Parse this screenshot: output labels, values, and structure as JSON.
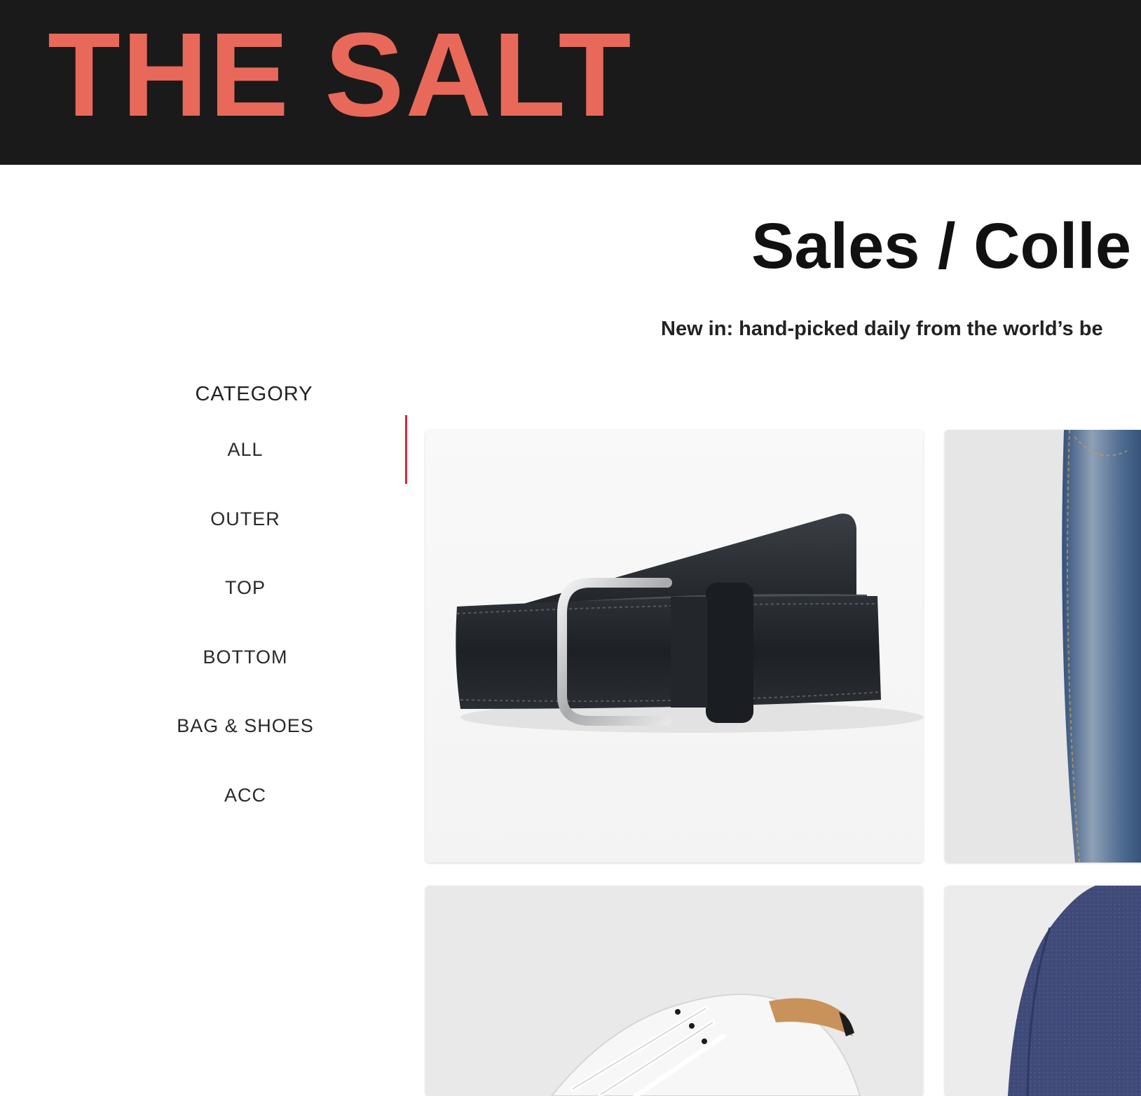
{
  "header": {
    "logo_text": "THE SALT",
    "logo_color": "#e8695a",
    "background": "#1b1a1a"
  },
  "main": {
    "title": "Sales / Colle",
    "subtitle": "New in: hand-picked daily from the world’s be"
  },
  "sidebar": {
    "heading": "CATEGORY",
    "active_index": 0,
    "active_color": "#d2283c",
    "items": [
      {
        "label": "ALL"
      },
      {
        "label": "OUTER"
      },
      {
        "label": "TOP"
      },
      {
        "label": "BOTTOM"
      },
      {
        "label": "BAG & SHOES"
      },
      {
        "label": "ACC"
      }
    ]
  },
  "products": [
    {
      "image": "black-leather-belt"
    },
    {
      "image": "blue-denim-jeans"
    },
    {
      "image": "white-leather-sneaker"
    },
    {
      "image": "navy-knit-sweater"
    }
  ]
}
